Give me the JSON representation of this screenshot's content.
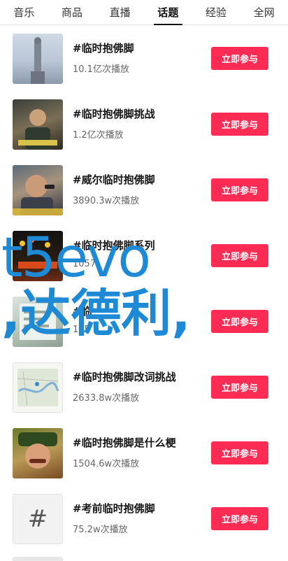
{
  "tabs": [
    {
      "label": "音乐",
      "active": false
    },
    {
      "label": "商品",
      "active": false
    },
    {
      "label": "直播",
      "active": false
    },
    {
      "label": "话题",
      "active": true
    },
    {
      "label": "经验",
      "active": false
    },
    {
      "label": "全网",
      "active": false
    }
  ],
  "join_label": "立即参与",
  "topics": [
    {
      "title": "#临时抱佛脚",
      "plays": "10.1亿次播放"
    },
    {
      "title": "#临时抱佛脚挑战",
      "plays": "1.2亿次播放"
    },
    {
      "title": "#威尔临时抱佛脚",
      "plays": "3890.3w次播放"
    },
    {
      "title": "#临时抱佛脚系列",
      "plays": "1057"
    },
    {
      "title": "#临",
      "plays": "155"
    },
    {
      "title": "#临时抱佛脚改词挑战",
      "plays": "2633.8w次播放"
    },
    {
      "title": "#临时抱佛脚是什么梗",
      "plays": "1504.6w次播放"
    },
    {
      "title": "#考前临时抱佛脚",
      "plays": "75.2w次播放"
    }
  ],
  "watermark": {
    "line1": "t5evo",
    "line2": ",达德利,"
  },
  "hash_glyph": "#",
  "accent_color": "#fe2c55"
}
